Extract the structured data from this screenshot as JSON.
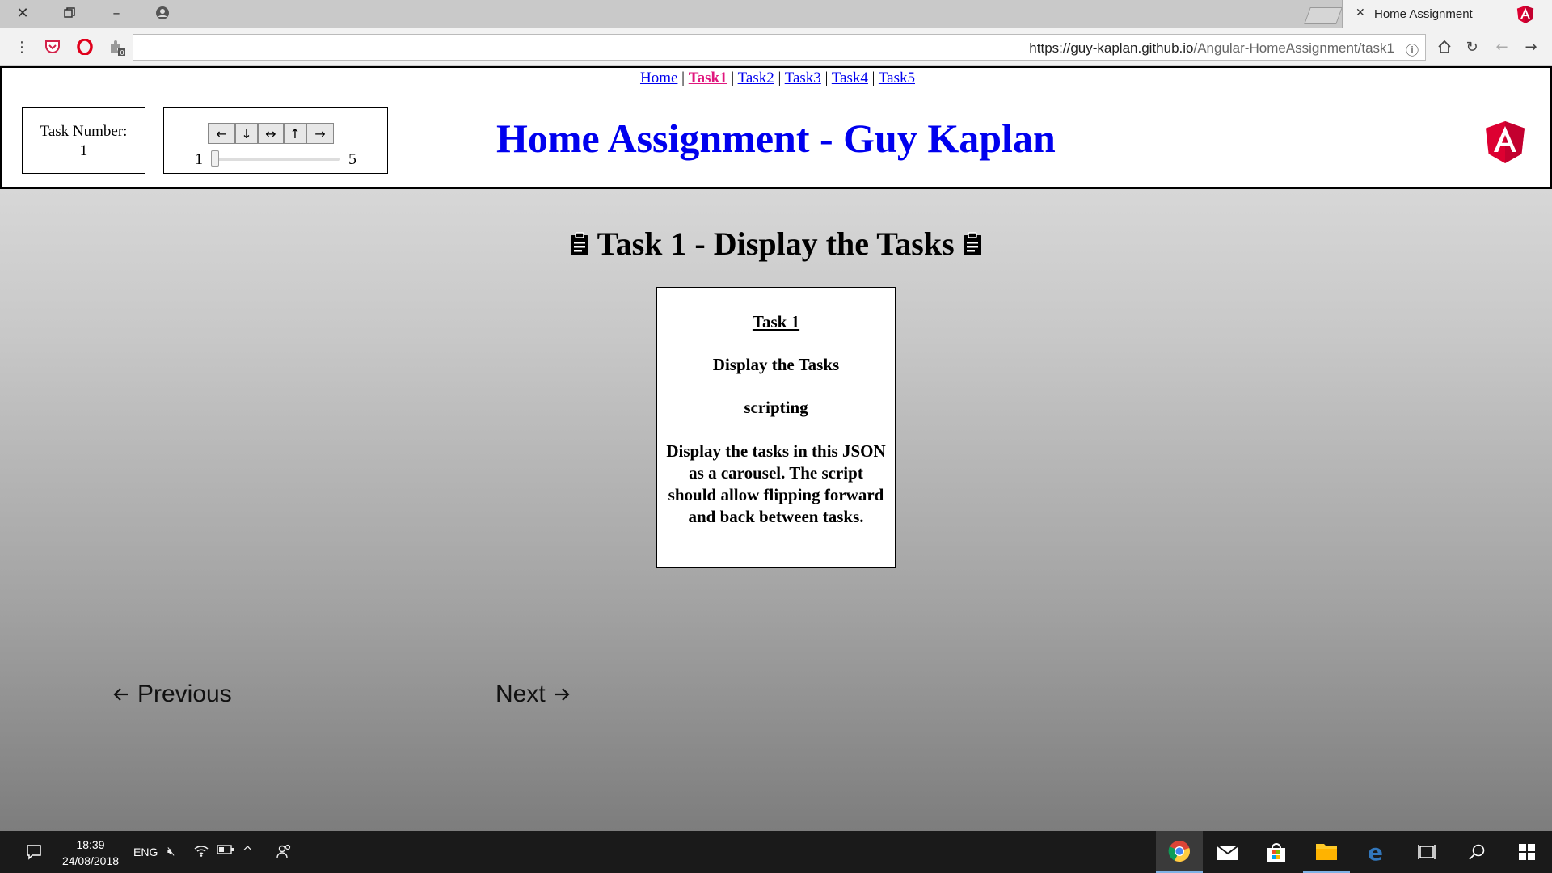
{
  "browser": {
    "tab_title": "Home Assignment",
    "url_host": "https://guy-kaplan.github.io",
    "url_path": "/Angular-HomeAssignment/task1"
  },
  "nav": {
    "links": [
      "Home",
      "Task1",
      "Task2",
      "Task3",
      "Task4",
      "Task5"
    ],
    "active": "Task1",
    "separator": "|"
  },
  "task_number_box": {
    "label": "Task Number:",
    "value": "1"
  },
  "controls": {
    "arrow_buttons": [
      "←",
      "↓",
      "↔",
      "↑",
      "→"
    ],
    "slider_min": "1",
    "slider_max": "5",
    "slider_value": 1
  },
  "header": {
    "title": "Home Assignment - Guy Kaplan",
    "logo_letter": "A"
  },
  "main": {
    "heading": "Task 1 - Display the Tasks"
  },
  "card": {
    "title": "Task 1",
    "name": "Display the Tasks",
    "category": "scripting",
    "description": "Display the tasks in this JSON as a carousel. The script should allow flipping forward and back between tasks."
  },
  "carousel_nav": {
    "prev_label": "Previous",
    "next_label": "Next"
  },
  "taskbar": {
    "time": "18:39",
    "date": "24/08/2018",
    "lang": "ENG"
  },
  "colors": {
    "link": "#0000ee",
    "active_link": "#e0167d",
    "title": "#0000ee",
    "angular_red": "#dd0031"
  }
}
